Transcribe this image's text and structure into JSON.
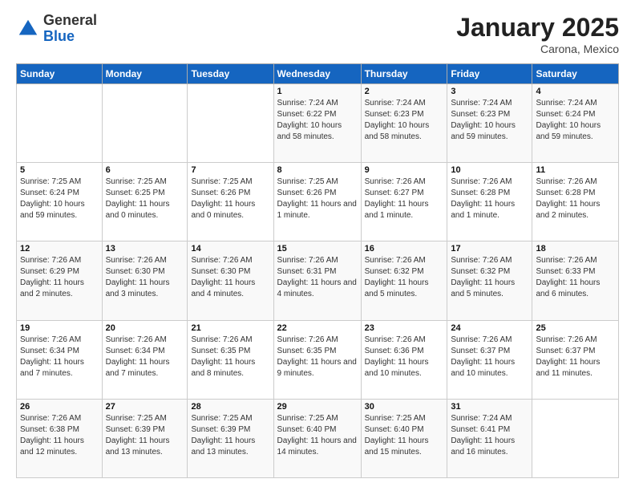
{
  "logo": {
    "general": "General",
    "blue": "Blue"
  },
  "header": {
    "month": "January 2025",
    "location": "Carona, Mexico"
  },
  "days_of_week": [
    "Sunday",
    "Monday",
    "Tuesday",
    "Wednesday",
    "Thursday",
    "Friday",
    "Saturday"
  ],
  "weeks": [
    [
      {
        "day": "",
        "info": ""
      },
      {
        "day": "",
        "info": ""
      },
      {
        "day": "",
        "info": ""
      },
      {
        "day": "1",
        "info": "Sunrise: 7:24 AM\nSunset: 6:22 PM\nDaylight: 10 hours and 58 minutes."
      },
      {
        "day": "2",
        "info": "Sunrise: 7:24 AM\nSunset: 6:23 PM\nDaylight: 10 hours and 58 minutes."
      },
      {
        "day": "3",
        "info": "Sunrise: 7:24 AM\nSunset: 6:23 PM\nDaylight: 10 hours and 59 minutes."
      },
      {
        "day": "4",
        "info": "Sunrise: 7:24 AM\nSunset: 6:24 PM\nDaylight: 10 hours and 59 minutes."
      }
    ],
    [
      {
        "day": "5",
        "info": "Sunrise: 7:25 AM\nSunset: 6:24 PM\nDaylight: 10 hours and 59 minutes."
      },
      {
        "day": "6",
        "info": "Sunrise: 7:25 AM\nSunset: 6:25 PM\nDaylight: 11 hours and 0 minutes."
      },
      {
        "day": "7",
        "info": "Sunrise: 7:25 AM\nSunset: 6:26 PM\nDaylight: 11 hours and 0 minutes."
      },
      {
        "day": "8",
        "info": "Sunrise: 7:25 AM\nSunset: 6:26 PM\nDaylight: 11 hours and 1 minute."
      },
      {
        "day": "9",
        "info": "Sunrise: 7:26 AM\nSunset: 6:27 PM\nDaylight: 11 hours and 1 minute."
      },
      {
        "day": "10",
        "info": "Sunrise: 7:26 AM\nSunset: 6:28 PM\nDaylight: 11 hours and 1 minute."
      },
      {
        "day": "11",
        "info": "Sunrise: 7:26 AM\nSunset: 6:28 PM\nDaylight: 11 hours and 2 minutes."
      }
    ],
    [
      {
        "day": "12",
        "info": "Sunrise: 7:26 AM\nSunset: 6:29 PM\nDaylight: 11 hours and 2 minutes."
      },
      {
        "day": "13",
        "info": "Sunrise: 7:26 AM\nSunset: 6:30 PM\nDaylight: 11 hours and 3 minutes."
      },
      {
        "day": "14",
        "info": "Sunrise: 7:26 AM\nSunset: 6:30 PM\nDaylight: 11 hours and 4 minutes."
      },
      {
        "day": "15",
        "info": "Sunrise: 7:26 AM\nSunset: 6:31 PM\nDaylight: 11 hours and 4 minutes."
      },
      {
        "day": "16",
        "info": "Sunrise: 7:26 AM\nSunset: 6:32 PM\nDaylight: 11 hours and 5 minutes."
      },
      {
        "day": "17",
        "info": "Sunrise: 7:26 AM\nSunset: 6:32 PM\nDaylight: 11 hours and 5 minutes."
      },
      {
        "day": "18",
        "info": "Sunrise: 7:26 AM\nSunset: 6:33 PM\nDaylight: 11 hours and 6 minutes."
      }
    ],
    [
      {
        "day": "19",
        "info": "Sunrise: 7:26 AM\nSunset: 6:34 PM\nDaylight: 11 hours and 7 minutes."
      },
      {
        "day": "20",
        "info": "Sunrise: 7:26 AM\nSunset: 6:34 PM\nDaylight: 11 hours and 7 minutes."
      },
      {
        "day": "21",
        "info": "Sunrise: 7:26 AM\nSunset: 6:35 PM\nDaylight: 11 hours and 8 minutes."
      },
      {
        "day": "22",
        "info": "Sunrise: 7:26 AM\nSunset: 6:35 PM\nDaylight: 11 hours and 9 minutes."
      },
      {
        "day": "23",
        "info": "Sunrise: 7:26 AM\nSunset: 6:36 PM\nDaylight: 11 hours and 10 minutes."
      },
      {
        "day": "24",
        "info": "Sunrise: 7:26 AM\nSunset: 6:37 PM\nDaylight: 11 hours and 10 minutes."
      },
      {
        "day": "25",
        "info": "Sunrise: 7:26 AM\nSunset: 6:37 PM\nDaylight: 11 hours and 11 minutes."
      }
    ],
    [
      {
        "day": "26",
        "info": "Sunrise: 7:26 AM\nSunset: 6:38 PM\nDaylight: 11 hours and 12 minutes."
      },
      {
        "day": "27",
        "info": "Sunrise: 7:25 AM\nSunset: 6:39 PM\nDaylight: 11 hours and 13 minutes."
      },
      {
        "day": "28",
        "info": "Sunrise: 7:25 AM\nSunset: 6:39 PM\nDaylight: 11 hours and 13 minutes."
      },
      {
        "day": "29",
        "info": "Sunrise: 7:25 AM\nSunset: 6:40 PM\nDaylight: 11 hours and 14 minutes."
      },
      {
        "day": "30",
        "info": "Sunrise: 7:25 AM\nSunset: 6:40 PM\nDaylight: 11 hours and 15 minutes."
      },
      {
        "day": "31",
        "info": "Sunrise: 7:24 AM\nSunset: 6:41 PM\nDaylight: 11 hours and 16 minutes."
      },
      {
        "day": "",
        "info": ""
      }
    ]
  ]
}
